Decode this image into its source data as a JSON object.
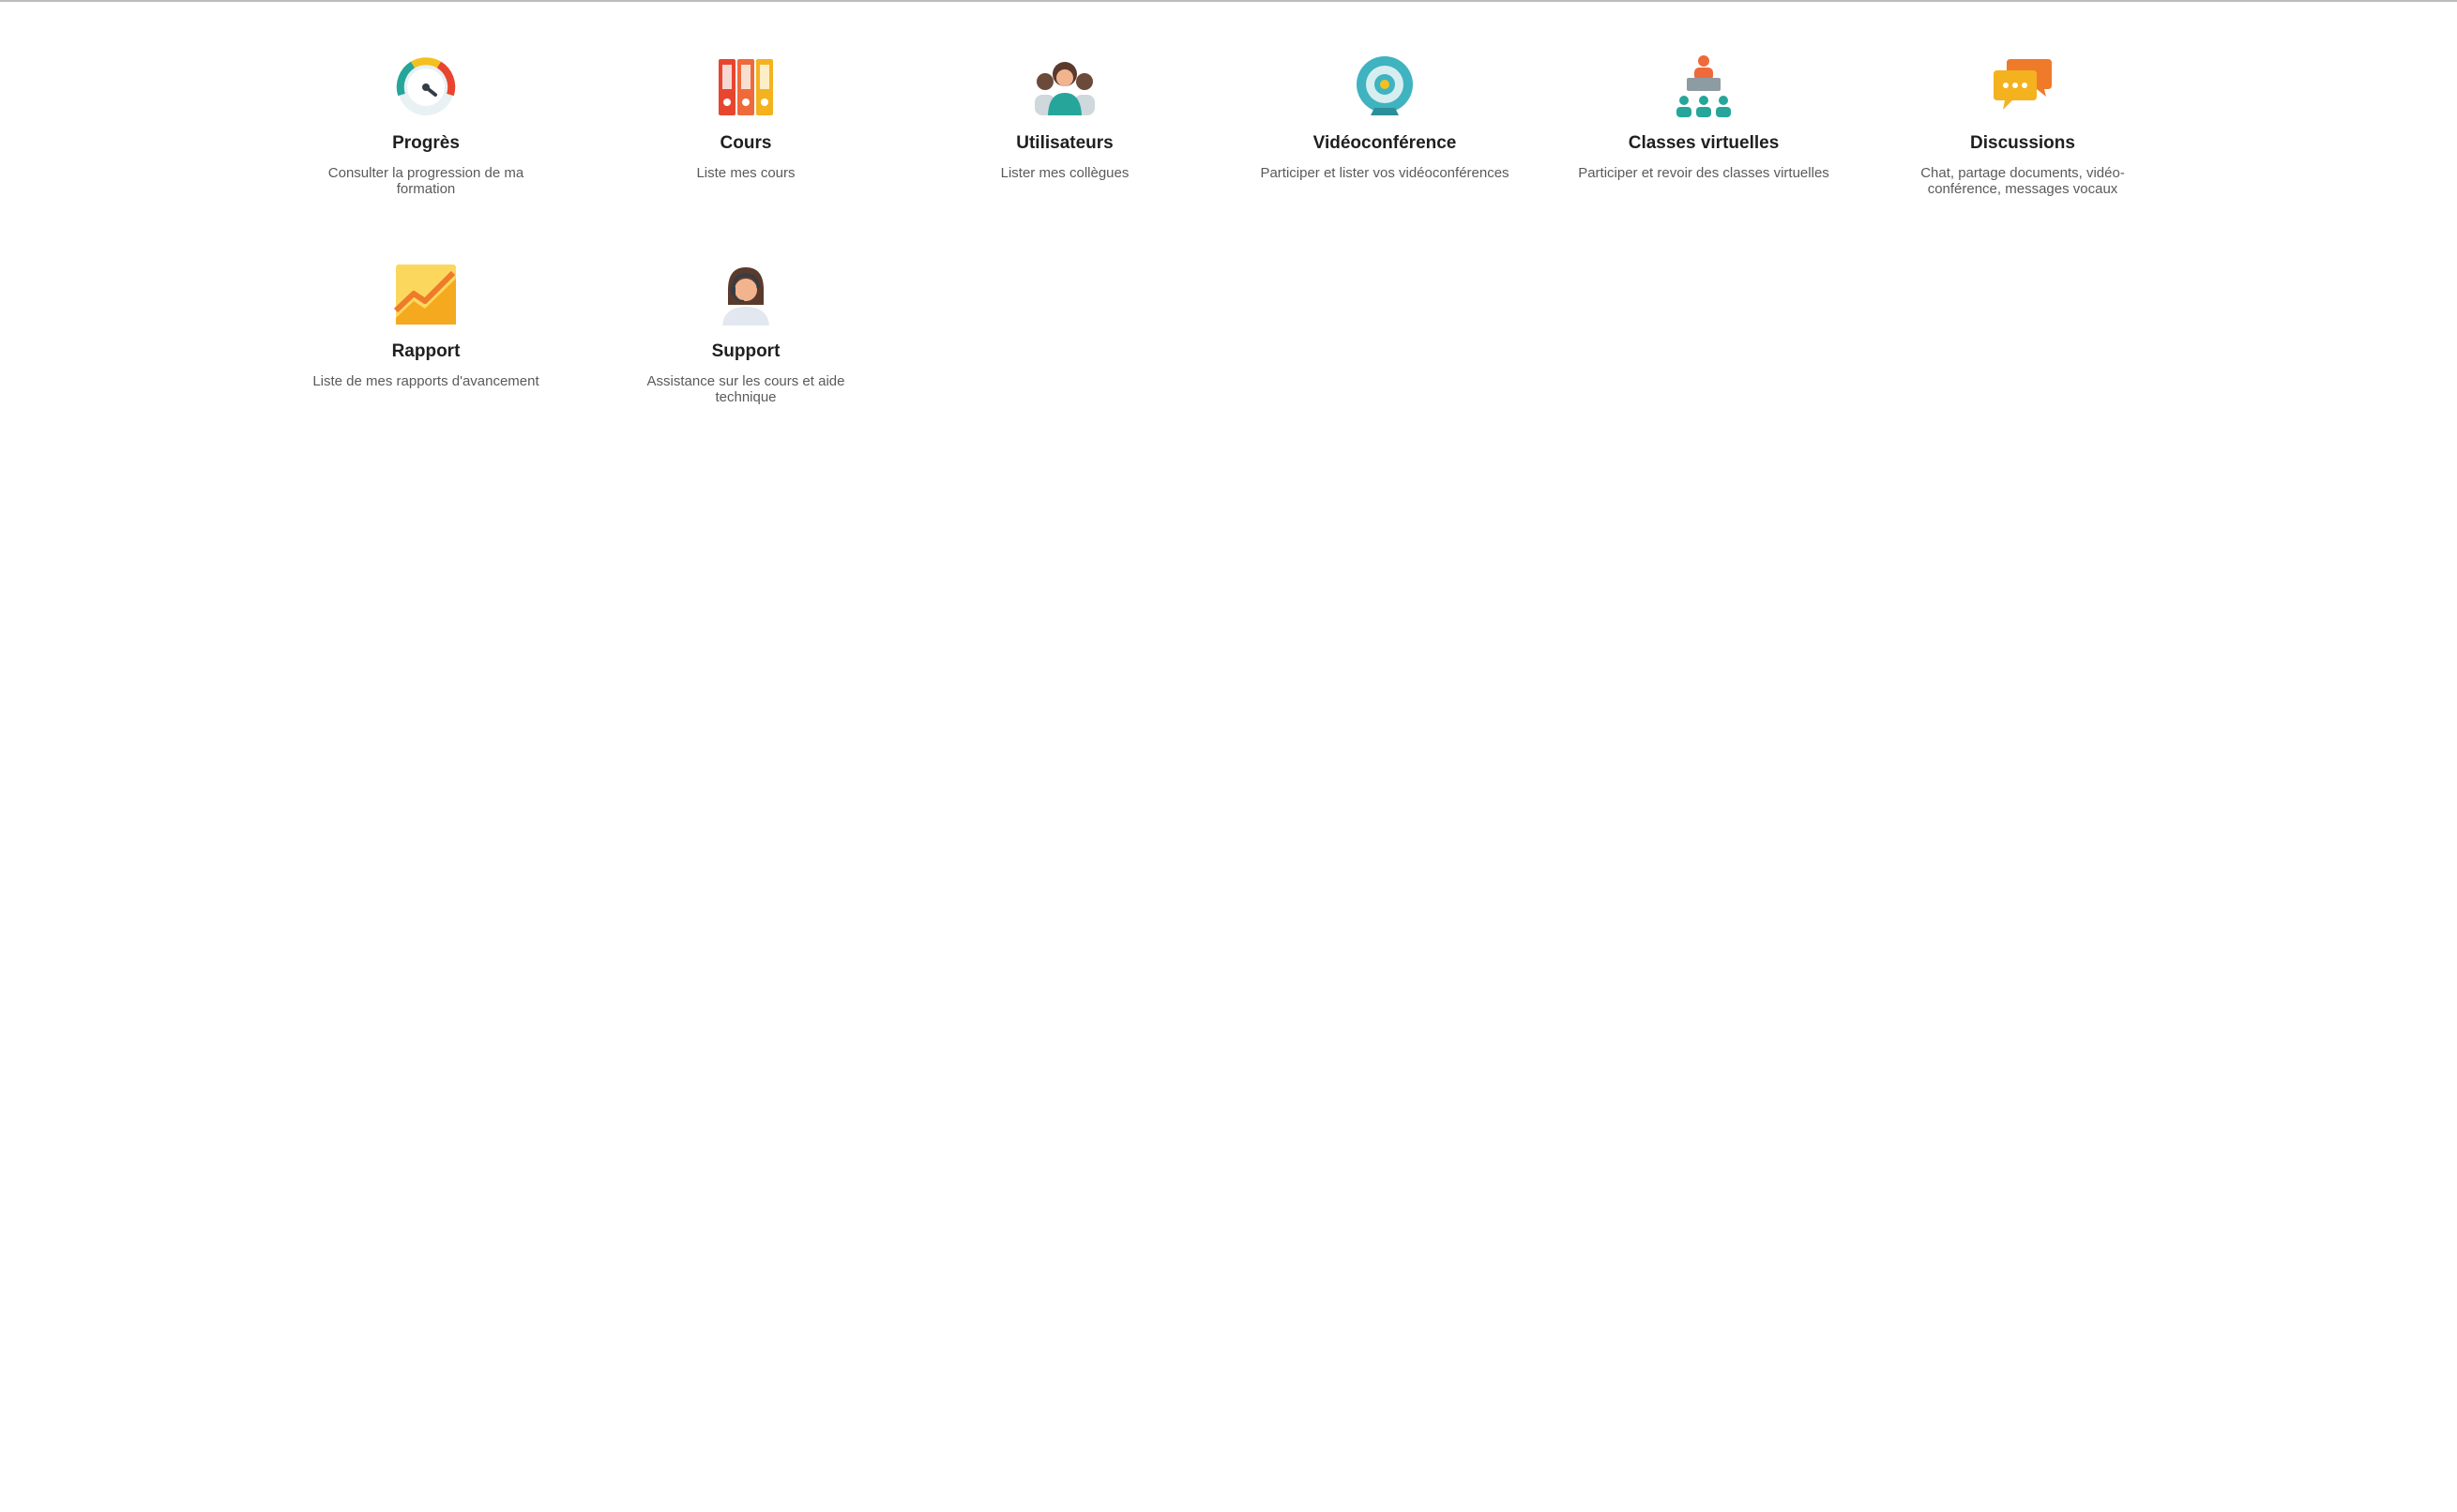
{
  "tiles": [
    {
      "icon": "speedometer-icon",
      "title": "Progrès",
      "desc": "Consulter la progression de ma formation"
    },
    {
      "icon": "binders-icon",
      "title": "Cours",
      "desc": "Liste mes cours"
    },
    {
      "icon": "users-group-icon",
      "title": "Utilisateurs",
      "desc": "Lister mes collègues"
    },
    {
      "icon": "webcam-icon",
      "title": "Vidéoconférence",
      "desc": "Participer et lister vos vidéoconférences"
    },
    {
      "icon": "virtual-class-icon",
      "title": "Classes virtuelles",
      "desc": "Participer et revoir des classes virtuelles"
    },
    {
      "icon": "chat-bubbles-icon",
      "title": "Discussions",
      "desc": "Chat, partage documents, vidéo-conférence, messages vocaux"
    },
    {
      "icon": "growth-chart-icon",
      "title": "Rapport",
      "desc": "Liste de mes rapports d'avancement"
    },
    {
      "icon": "support-agent-icon",
      "title": "Support",
      "desc": "Assistance sur les cours et aide technique"
    }
  ]
}
